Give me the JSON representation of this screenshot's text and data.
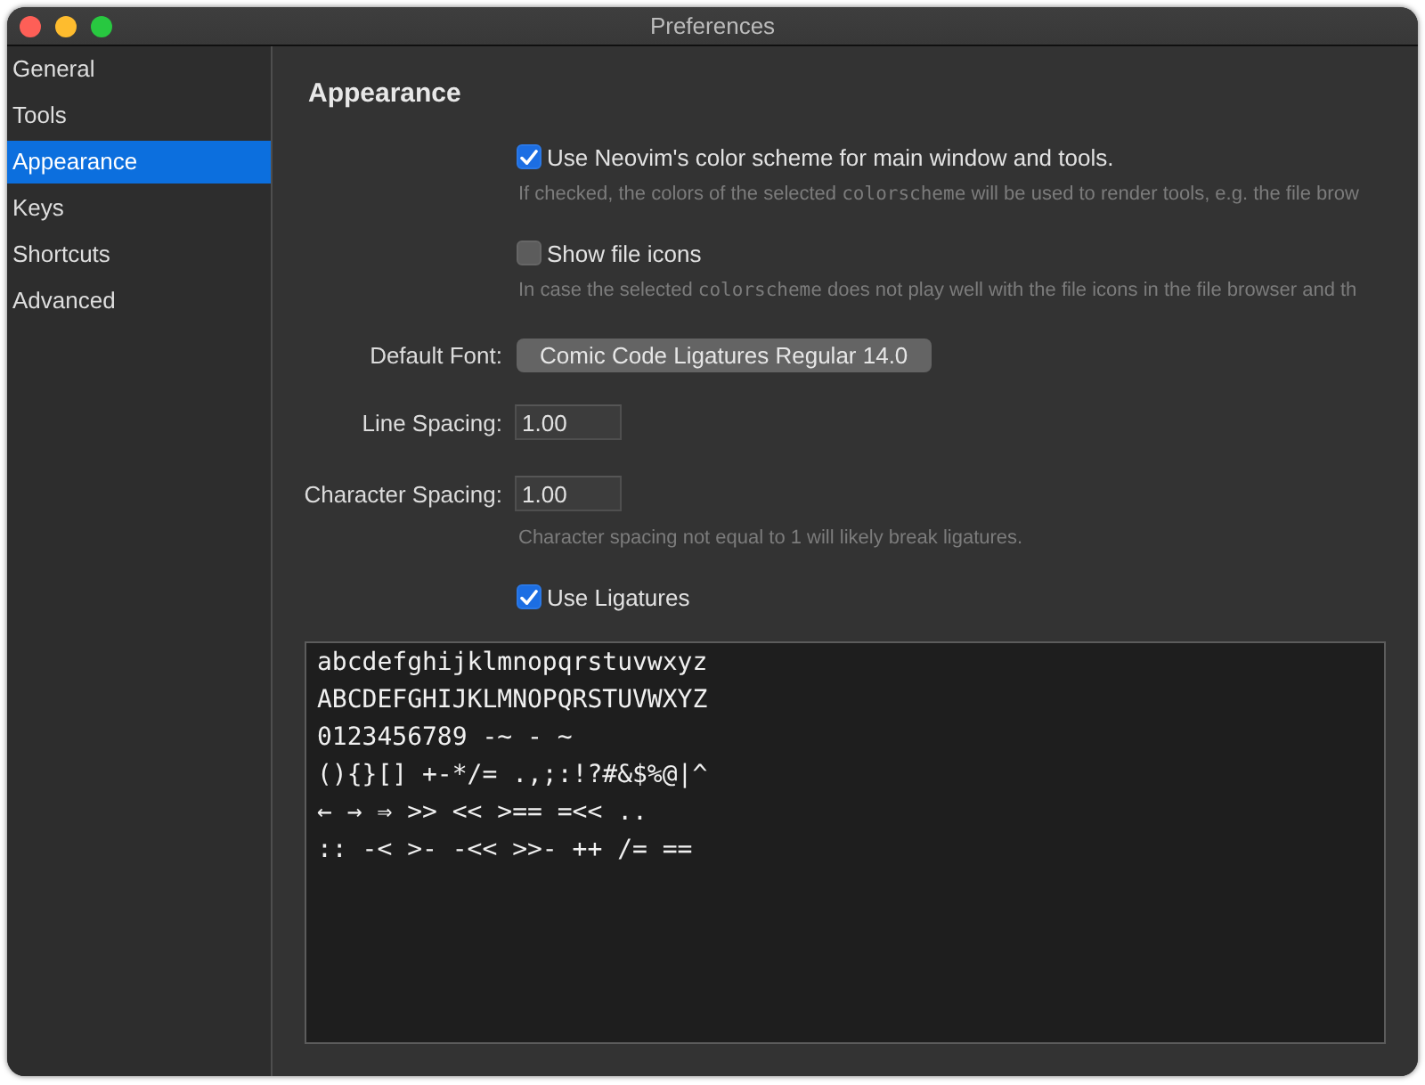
{
  "window": {
    "title": "Preferences"
  },
  "sidebar": {
    "items": [
      {
        "label": "General",
        "selected": false
      },
      {
        "label": "Tools",
        "selected": false
      },
      {
        "label": "Appearance",
        "selected": true
      },
      {
        "label": "Keys",
        "selected": false
      },
      {
        "label": "Shortcuts",
        "selected": false
      },
      {
        "label": "Advanced",
        "selected": false
      }
    ]
  },
  "content": {
    "heading": "Appearance",
    "rows": [
      {
        "kind": "checkbox",
        "label": "Use Neovim's color scheme for main window and tools.",
        "checked": true
      },
      {
        "kind": "note",
        "parts": [
          {
            "kind": "text",
            "text": "If checked, the colors of the selected "
          },
          {
            "kind": "code",
            "text": "colorscheme"
          },
          {
            "kind": "text",
            "text": " will be used to render tools, e.g. the file brow"
          }
        ]
      },
      {
        "kind": "checkbox",
        "label": "Show file icons",
        "checked": false
      },
      {
        "kind": "note",
        "parts": [
          {
            "kind": "text",
            "text": "In case the selected "
          },
          {
            "kind": "code",
            "text": "colorscheme"
          },
          {
            "kind": "text",
            "text": " does not play well with the file icons in the file browser and th"
          }
        ]
      },
      {
        "kind": "button",
        "label": "Default Font:",
        "value": "Comic Code Ligatures Regular 14.0"
      },
      {
        "kind": "field",
        "label": "Line Spacing:",
        "value": "1.00"
      },
      {
        "kind": "field",
        "label": "Character Spacing:",
        "value": "1.00"
      },
      {
        "kind": "note",
        "parts": [
          {
            "kind": "text",
            "text": "Character spacing not equal to 1 will likely break ligatures."
          }
        ]
      },
      {
        "kind": "checkbox",
        "label": "Use Ligatures",
        "checked": true
      }
    ],
    "preview": {
      "lines": [
        "abcdefghijklmnopqrstuvwxyz",
        "ABCDEFGHIJKLMNOPQRSTUVWXYZ",
        "0123456789 -~ - ~",
        "(){}[] +-*/= .,;:!?#&$%@|^",
        "← → ⇒ >> << >== =<< ..",
        ":: -< >- -<< >>- ++ /= =="
      ]
    }
  }
}
